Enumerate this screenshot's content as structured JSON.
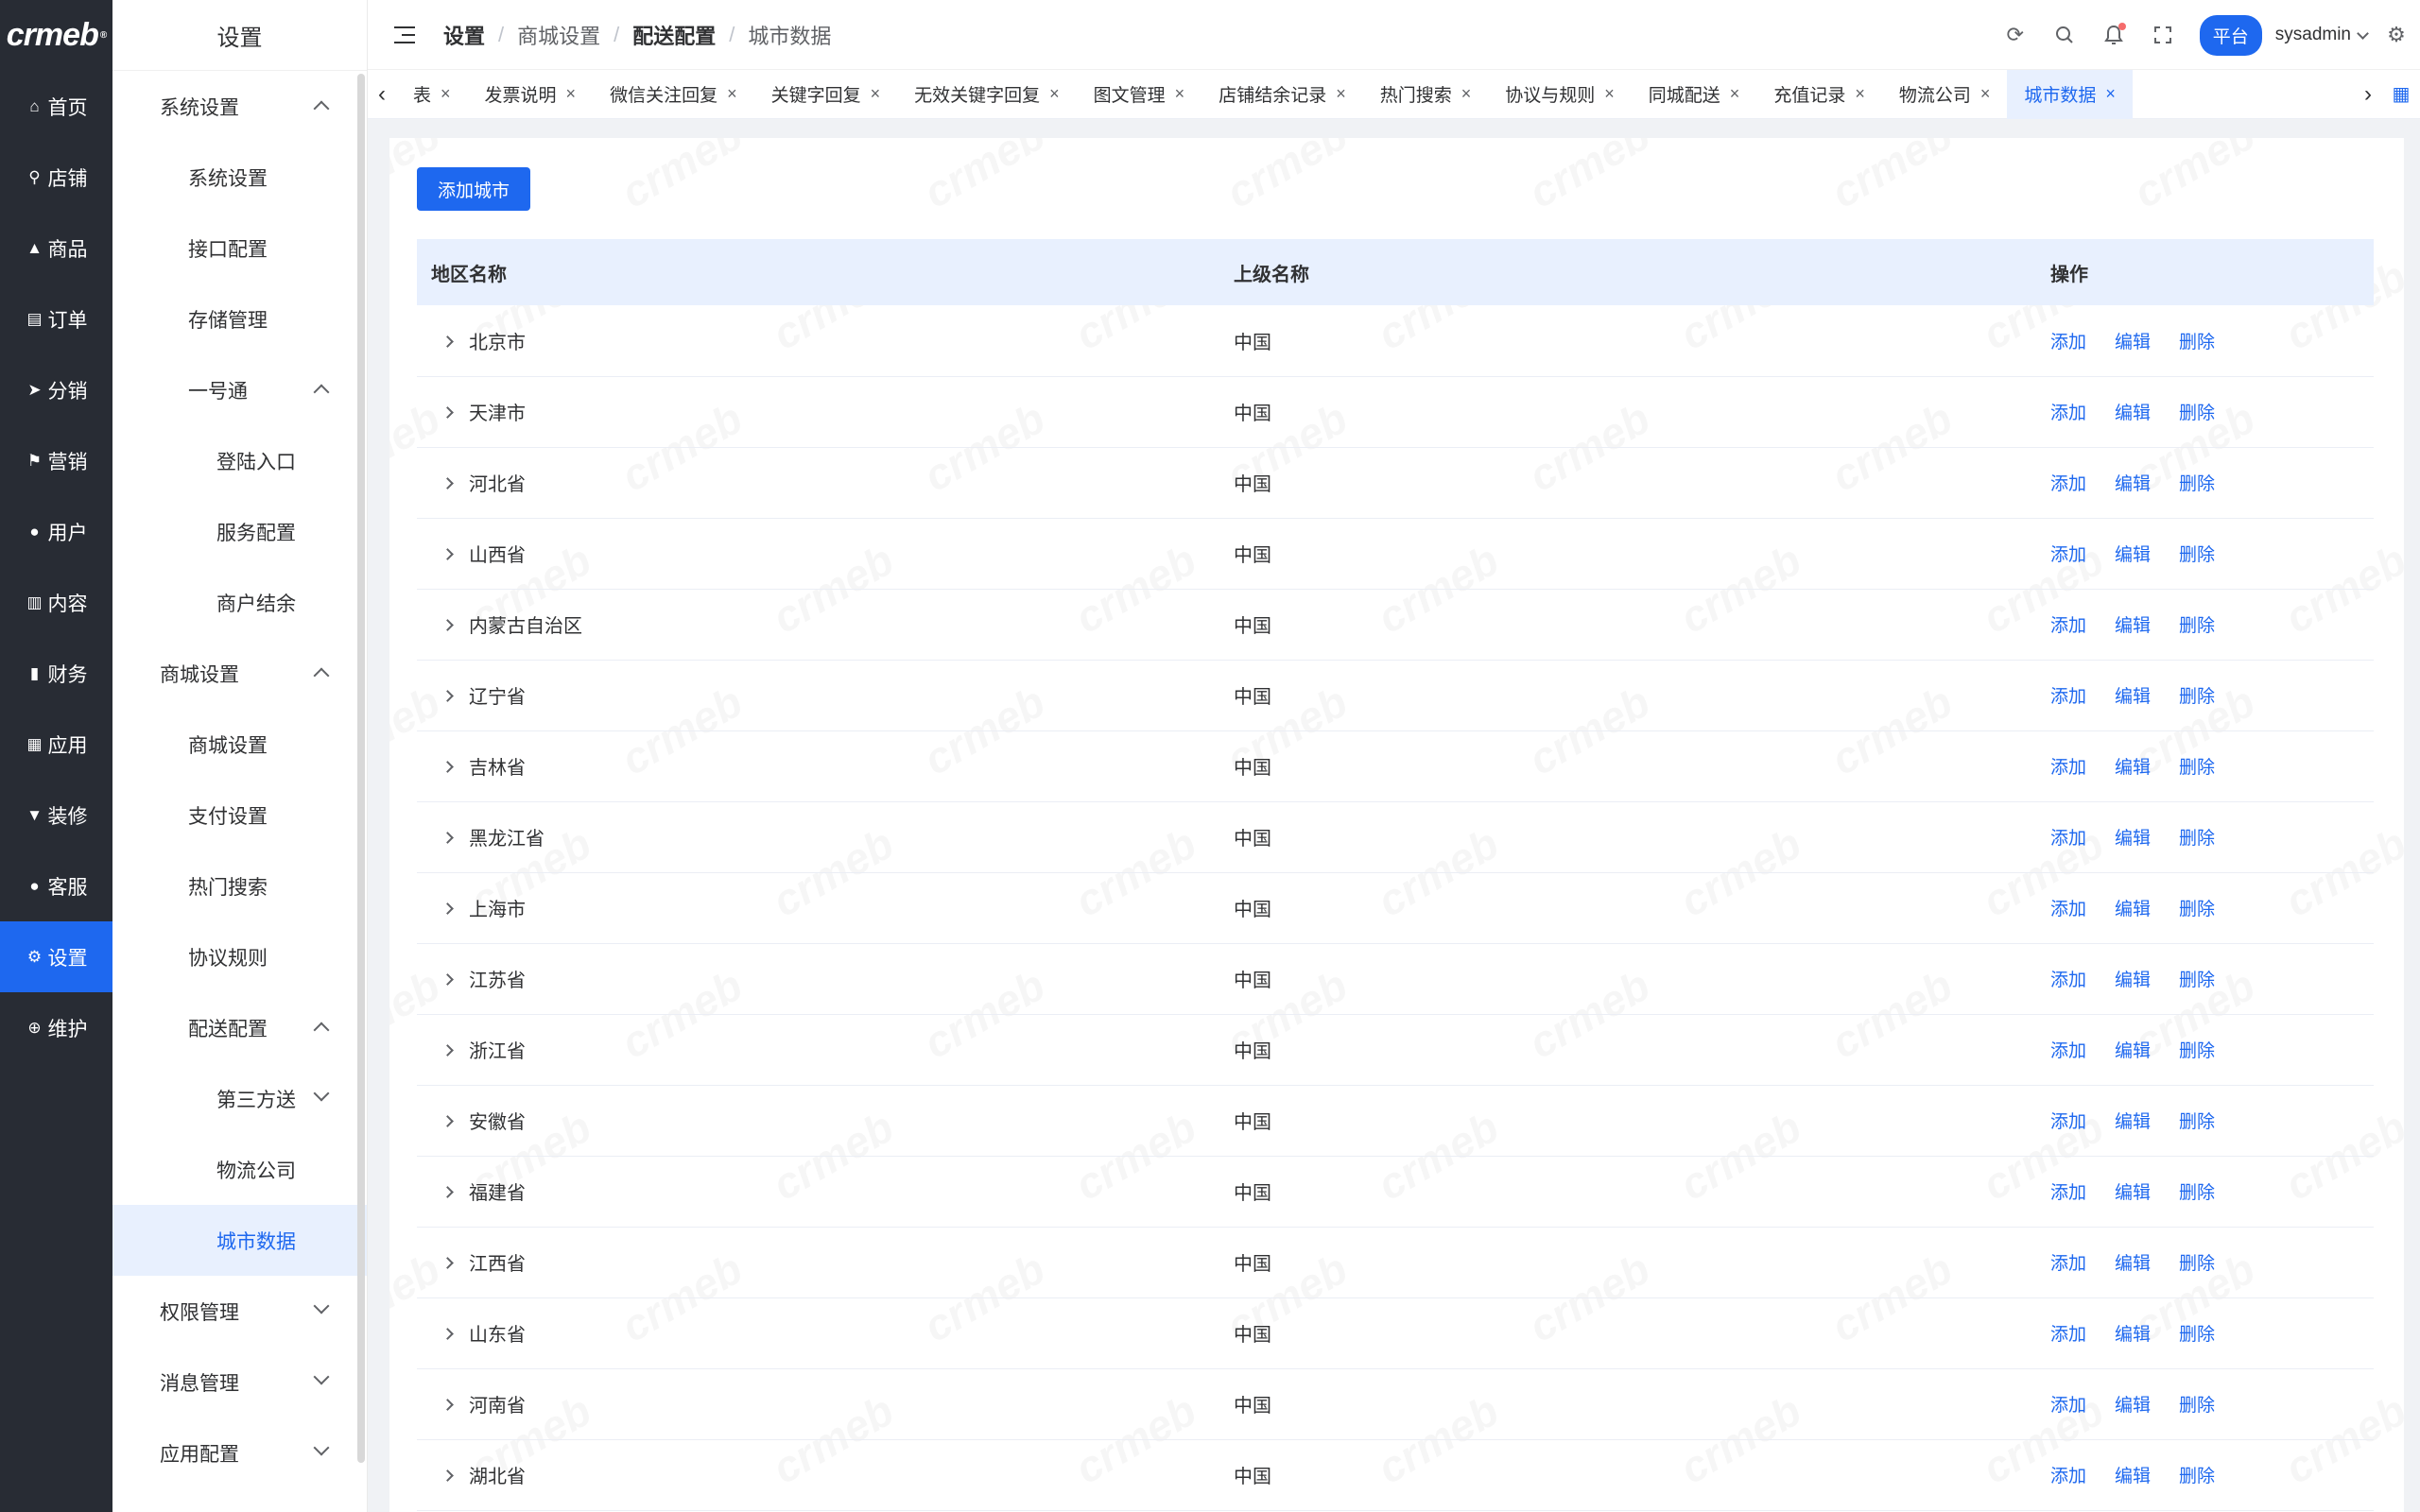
{
  "brand": {
    "logo_text": "crmeb",
    "logo_mark": "®"
  },
  "rail": [
    {
      "label": "首页",
      "icon": "home-icon",
      "glyph": "⌂"
    },
    {
      "label": "店铺",
      "icon": "store-icon",
      "glyph": "⚲"
    },
    {
      "label": "商品",
      "icon": "bag-icon",
      "glyph": "▲"
    },
    {
      "label": "订单",
      "icon": "clipboard-icon",
      "glyph": "▤"
    },
    {
      "label": "分销",
      "icon": "send-icon",
      "glyph": "➤"
    },
    {
      "label": "营销",
      "icon": "flag-icon",
      "glyph": "⚑"
    },
    {
      "label": "用户",
      "icon": "user-icon",
      "glyph": "●"
    },
    {
      "label": "内容",
      "icon": "book-icon",
      "glyph": "▥"
    },
    {
      "label": "财务",
      "icon": "bar-chart-icon",
      "glyph": "▮"
    },
    {
      "label": "应用",
      "icon": "grid-icon",
      "glyph": "▦"
    },
    {
      "label": "装修",
      "icon": "brush-icon",
      "glyph": "▼"
    },
    {
      "label": "客服",
      "icon": "agent-icon",
      "glyph": "●"
    },
    {
      "label": "设置",
      "icon": "gear-icon",
      "glyph": "⚙"
    },
    {
      "label": "维护",
      "icon": "plus-circle-icon",
      "glyph": "⊕"
    }
  ],
  "subnav": {
    "title": "设置",
    "items": [
      {
        "label": "系统设置",
        "level": 1,
        "chevron": "up"
      },
      {
        "label": "系统设置",
        "level": 2
      },
      {
        "label": "接口配置",
        "level": 2
      },
      {
        "label": "存储管理",
        "level": 2
      },
      {
        "label": "一号通",
        "level": 2,
        "chevron": "up"
      },
      {
        "label": "登陆入口",
        "level": 3
      },
      {
        "label": "服务配置",
        "level": 3
      },
      {
        "label": "商户结余",
        "level": 3
      },
      {
        "label": "商城设置",
        "level": 1,
        "chevron": "up"
      },
      {
        "label": "商城设置",
        "level": 2
      },
      {
        "label": "支付设置",
        "level": 2
      },
      {
        "label": "热门搜索",
        "level": 2
      },
      {
        "label": "协议规则",
        "level": 2
      },
      {
        "label": "配送配置",
        "level": 2,
        "chevron": "up"
      },
      {
        "label": "第三方送",
        "level": 3,
        "chevron": "down"
      },
      {
        "label": "物流公司",
        "level": 3
      },
      {
        "label": "城市数据",
        "level": 3,
        "active": true
      },
      {
        "label": "权限管理",
        "level": 1,
        "chevron": "down"
      },
      {
        "label": "消息管理",
        "level": 1,
        "chevron": "down"
      },
      {
        "label": "应用配置",
        "level": 1,
        "chevron": "down"
      }
    ]
  },
  "header": {
    "breadcrumb": [
      "设置",
      "商城设置",
      "配送配置",
      "城市数据"
    ],
    "platform_label": "平台",
    "username": "sysadmin"
  },
  "tabs": [
    {
      "label": "表"
    },
    {
      "label": "发票说明"
    },
    {
      "label": "微信关注回复"
    },
    {
      "label": "关键字回复"
    },
    {
      "label": "无效关键字回复"
    },
    {
      "label": "图文管理"
    },
    {
      "label": "店铺结余记录"
    },
    {
      "label": "热门搜索"
    },
    {
      "label": "协议与规则"
    },
    {
      "label": "同城配送"
    },
    {
      "label": "充值记录"
    },
    {
      "label": "物流公司"
    },
    {
      "label": "城市数据",
      "active": true
    }
  ],
  "main": {
    "add_button": "添加城市",
    "columns": [
      "地区名称",
      "上级名称",
      "操作"
    ],
    "actions": [
      "添加",
      "编辑",
      "删除"
    ],
    "rows": [
      {
        "name": "北京市",
        "parent": "中国"
      },
      {
        "name": "天津市",
        "parent": "中国"
      },
      {
        "name": "河北省",
        "parent": "中国"
      },
      {
        "name": "山西省",
        "parent": "中国"
      },
      {
        "name": "内蒙古自治区",
        "parent": "中国"
      },
      {
        "name": "辽宁省",
        "parent": "中国"
      },
      {
        "name": "吉林省",
        "parent": "中国"
      },
      {
        "name": "黑龙江省",
        "parent": "中国"
      },
      {
        "name": "上海市",
        "parent": "中国"
      },
      {
        "name": "江苏省",
        "parent": "中国"
      },
      {
        "name": "浙江省",
        "parent": "中国"
      },
      {
        "name": "安徽省",
        "parent": "中国"
      },
      {
        "name": "福建省",
        "parent": "中国"
      },
      {
        "name": "江西省",
        "parent": "中国"
      },
      {
        "name": "山东省",
        "parent": "中国"
      },
      {
        "name": "河南省",
        "parent": "中国"
      },
      {
        "name": "湖北省",
        "parent": "中国"
      }
    ]
  },
  "colors": {
    "accent": "#1e68ef",
    "rail_bg": "#282c34",
    "header_row": "#e8f0fe"
  }
}
